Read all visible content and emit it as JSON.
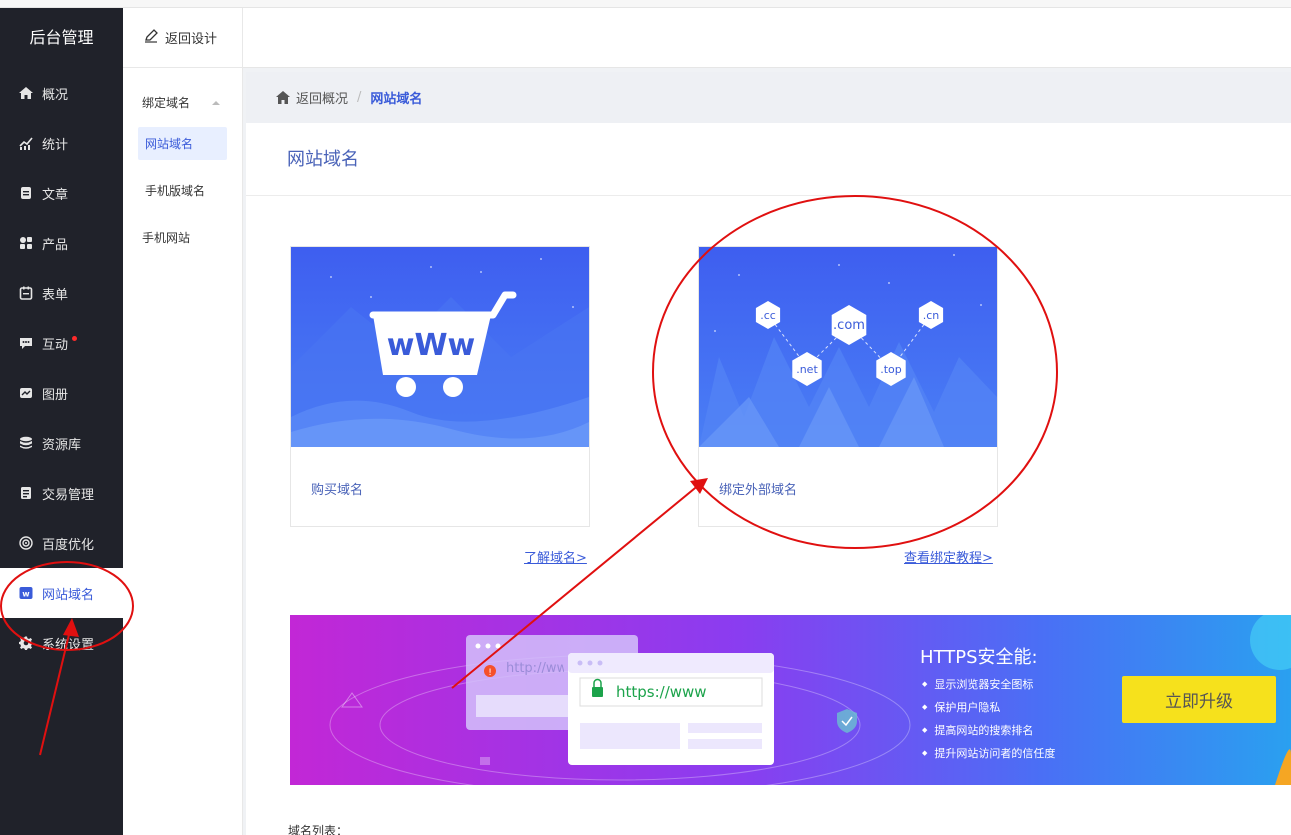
{
  "sidebar": {
    "brand": "后台管理",
    "items": [
      {
        "label": "概况",
        "icon": "home-icon"
      },
      {
        "label": "统计",
        "icon": "chart-icon"
      },
      {
        "label": "文章",
        "icon": "article-icon"
      },
      {
        "label": "产品",
        "icon": "product-icon"
      },
      {
        "label": "表单",
        "icon": "form-icon"
      },
      {
        "label": "互动",
        "icon": "chat-icon"
      },
      {
        "label": "图册",
        "icon": "gallery-icon"
      },
      {
        "label": "资源库",
        "icon": "database-icon"
      },
      {
        "label": "交易管理",
        "icon": "trade-icon"
      },
      {
        "label": "百度优化",
        "icon": "seo-icon"
      },
      {
        "label": "网站域名",
        "icon": "domain-icon"
      },
      {
        "label": "系统设置",
        "icon": "gear-icon"
      }
    ],
    "active_index": 10
  },
  "subbar": {
    "back_label": "返回设计",
    "group_label": "绑定域名",
    "items": [
      "网站域名",
      "手机版域名",
      "手机网站"
    ]
  },
  "breadcrumb": {
    "home_label": "返回概况",
    "separator": "/",
    "current": "网站域名"
  },
  "main": {
    "title": "网站域名",
    "cards": [
      {
        "label": "购买域名"
      },
      {
        "label": "绑定外部域名"
      }
    ],
    "links": [
      "了解域名>",
      "查看绑定教程>"
    ],
    "domain_tags": [
      ".cc",
      ".com",
      ".cn",
      ".net",
      ".top"
    ],
    "cart_text": "wWw",
    "banner": {
      "title": "HTTPS安全能:",
      "bullets": [
        "显示浏览器安全图标",
        "保护用户隐私",
        "提高网站的搜索排名",
        "提升网站访问者的信任度"
      ],
      "button": "立即升级",
      "http_text": "http://ww",
      "https_text": "https://www"
    },
    "list_label": "域名列表："
  }
}
